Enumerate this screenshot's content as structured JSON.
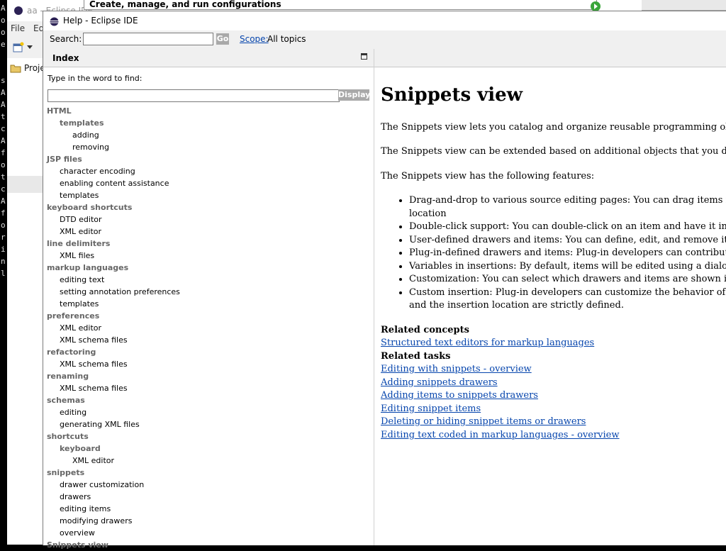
{
  "background": {
    "terminal_chars": [
      "A",
      "o",
      "o",
      "e",
      "",
      "",
      "s",
      "A",
      "A",
      "t",
      "c",
      "A",
      "f",
      "o",
      "t",
      "c",
      "A",
      "f",
      "o",
      "r",
      "i",
      "n",
      "l"
    ],
    "eclipse_title": "aa - Eclipse IDE",
    "menu": [
      "File",
      "Ed"
    ],
    "project_explorer_label": "Proje",
    "tooltip": "Create, manage, and run configurations"
  },
  "help_window": {
    "title": "Help - Eclipse IDE",
    "search": {
      "label": "Search:",
      "value": "",
      "go_label": "Go",
      "scope_label": "Scope:",
      "scope_value": "All topics"
    }
  },
  "index": {
    "header": "Index",
    "find_label": "Type in the word to find:",
    "find_value": "",
    "display_label": "Display",
    "entries": [
      {
        "text": "HTML",
        "level": "l0"
      },
      {
        "text": "templates",
        "level": "l1b"
      },
      {
        "text": "adding",
        "level": "l2"
      },
      {
        "text": "removing",
        "level": "l2"
      },
      {
        "text": "JSP files",
        "level": "l0"
      },
      {
        "text": "character encoding",
        "level": "l1"
      },
      {
        "text": "enabling content assistance",
        "level": "l1"
      },
      {
        "text": "templates",
        "level": "l1"
      },
      {
        "text": "keyboard shortcuts",
        "level": "l0"
      },
      {
        "text": "DTD editor",
        "level": "l1"
      },
      {
        "text": "XML editor",
        "level": "l1"
      },
      {
        "text": "line delimiters",
        "level": "l0"
      },
      {
        "text": "XML files",
        "level": "l1"
      },
      {
        "text": "markup languages",
        "level": "l0"
      },
      {
        "text": "editing text",
        "level": "l1"
      },
      {
        "text": "setting annotation preferences",
        "level": "l1"
      },
      {
        "text": "templates",
        "level": "l1"
      },
      {
        "text": "preferences",
        "level": "l0"
      },
      {
        "text": "XML editor",
        "level": "l1"
      },
      {
        "text": "XML schema files",
        "level": "l1"
      },
      {
        "text": "refactoring",
        "level": "l0"
      },
      {
        "text": "XML schema files",
        "level": "l1"
      },
      {
        "text": "renaming",
        "level": "l0"
      },
      {
        "text": "XML schema files",
        "level": "l1"
      },
      {
        "text": "schemas",
        "level": "l0"
      },
      {
        "text": "editing",
        "level": "l1"
      },
      {
        "text": "generating XML files",
        "level": "l1"
      },
      {
        "text": "shortcuts",
        "level": "l0"
      },
      {
        "text": "keyboard",
        "level": "l1b"
      },
      {
        "text": "XML editor",
        "level": "l2"
      },
      {
        "text": "snippets",
        "level": "l0"
      },
      {
        "text": "drawer customization",
        "level": "l1"
      },
      {
        "text": "drawers",
        "level": "l1"
      },
      {
        "text": "editing items",
        "level": "l1"
      },
      {
        "text": "modifying drawers",
        "level": "l1"
      },
      {
        "text": "overview",
        "level": "l1"
      },
      {
        "text": "Snippets view",
        "level": "l0"
      }
    ]
  },
  "content": {
    "title": "Snippets view",
    "p1": "The Snippets view lets you catalog and organize reusable programming obje",
    "p2": "The Snippets view can be extended based on additional objects that you defi",
    "p3": "The Snippets view has the following features:",
    "features": [
      [
        "Drag-and-drop to various source editing pages: You can drag items fro",
        "location"
      ],
      [
        "Double-click support: You can double-click on an item and have it ins"
      ],
      [
        "User-defined drawers and items: You can define, edit, and remove iter"
      ],
      [
        "Plug-in-defined drawers and items: Plug-in developers can contribute"
      ],
      [
        "Variables in insertions: By default, items will be edited using a dialog"
      ],
      [
        "Customization: You can select which drawers and items are shown in"
      ],
      [
        "Custom insertion: Plug-in developers can customize the behavior of it",
        "and the insertion location are strictly defined."
      ]
    ],
    "related_concepts_heading": "Related concepts",
    "related_concepts": [
      "Structured text editors for markup languages"
    ],
    "related_tasks_heading": "Related tasks",
    "related_tasks": [
      "Editing with snippets - overview",
      "Adding snippets drawers",
      "Adding items to snippets drawers",
      "Editing snippet items",
      "Deleting or hiding snippet items or drawers",
      "Editing text coded in markup languages - overview"
    ]
  }
}
